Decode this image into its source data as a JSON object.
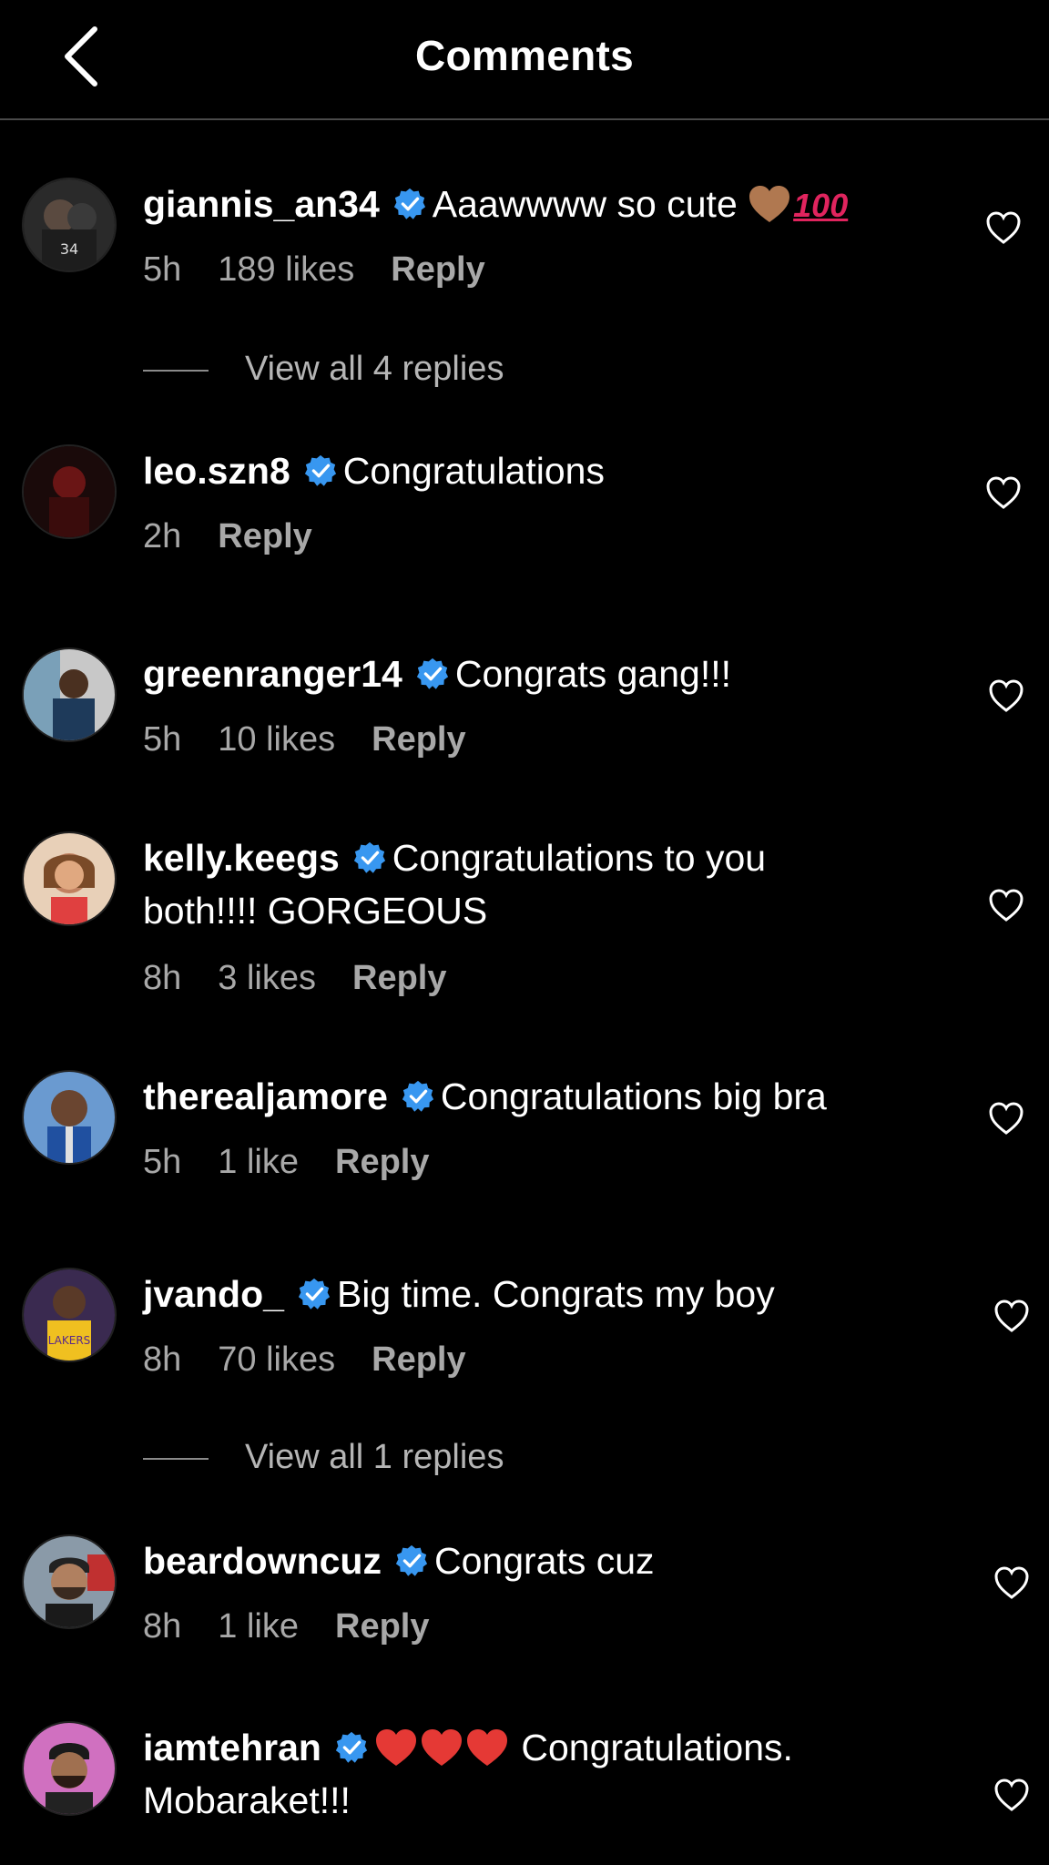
{
  "header": {
    "title": "Comments"
  },
  "comments": [
    {
      "username": "giannis_an34",
      "text": "Aaawwww so cute",
      "time": "5h",
      "likes": "189 likes",
      "reply": "Reply",
      "emoji_hundred": "100"
    },
    {
      "username": "leo.szn8",
      "text": "Congratulations",
      "time": "2h",
      "reply": "Reply"
    },
    {
      "username": "greenranger14",
      "text": "Congrats gang!!!",
      "time": "5h",
      "likes": "10 likes",
      "reply": "Reply"
    },
    {
      "username": "kelly.keegs",
      "text_line1": "Congratulations to you",
      "text_line2": "both!!!! GORGEOUS",
      "time": "8h",
      "likes": "3 likes",
      "reply": "Reply"
    },
    {
      "username": "therealjamore",
      "text": "Congratulations big bra",
      "time": "5h",
      "likes": "1 like",
      "reply": "Reply"
    },
    {
      "username": "jvando_",
      "text": "Big time. Congrats my boy",
      "time": "8h",
      "likes": "70 likes",
      "reply": "Reply"
    },
    {
      "username": "beardowncuz",
      "text": "Congrats cuz",
      "time": "8h",
      "likes": "1 like",
      "reply": "Reply"
    },
    {
      "username": "iamtehran",
      "text_line1": "Congratulations.",
      "text_line2": "Mobaraket!!!"
    }
  ],
  "view_replies": [
    "View all 4 replies",
    "View all 1 replies"
  ],
  "colors": {
    "background": "#000000",
    "meta": "#a8a8a8",
    "verified": "#3897f0",
    "heart_emoji": "#e0245e"
  },
  "icons": {
    "back": "chevron-left-icon",
    "like": "heart-outline-icon",
    "verified": "verified-badge-icon"
  }
}
